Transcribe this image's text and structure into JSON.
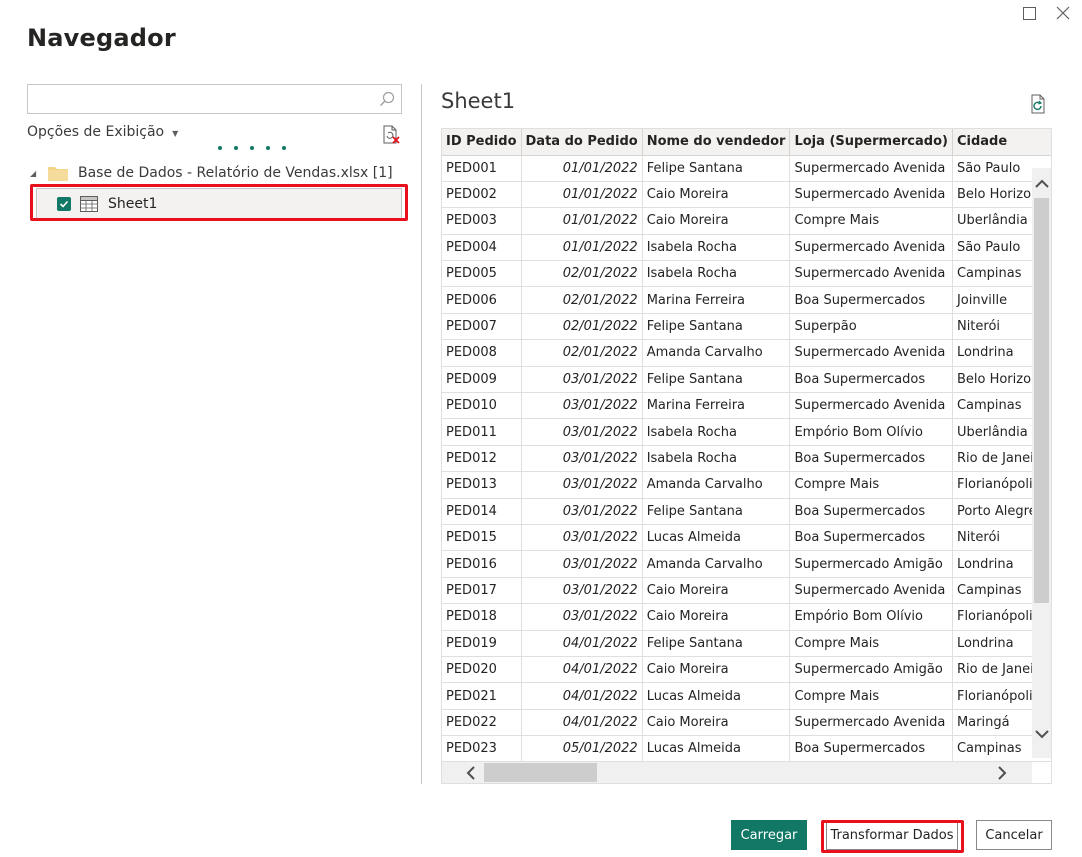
{
  "window": {
    "maximize_icon": "maximize-icon",
    "close_icon": "close-icon"
  },
  "title": "Navegador",
  "search": {
    "value": "",
    "placeholder": "",
    "icon": "search-icon"
  },
  "view_options": {
    "label": "Opções de Exibição",
    "icon": "chevron-down-icon"
  },
  "tree": {
    "root_label": "Base de Dados - Relatório de Vendas.xlsx [1]",
    "item_label": "Sheet1",
    "item_checked": true
  },
  "preview": {
    "title": "Sheet1",
    "columns": [
      "ID Pedido",
      "Data do Pedido",
      "Nome do vendedor",
      "Loja (Supermercado)",
      "Cidade"
    ],
    "rows": [
      [
        "PED001",
        "01/01/2022",
        "Felipe Santana",
        "Supermercado Avenida",
        "São Paulo"
      ],
      [
        "PED002",
        "01/01/2022",
        "Caio Moreira",
        "Supermercado Avenida",
        "Belo Horizonte"
      ],
      [
        "PED003",
        "01/01/2022",
        "Caio Moreira",
        "Compre Mais",
        "Uberlândia"
      ],
      [
        "PED004",
        "01/01/2022",
        "Isabela Rocha",
        "Supermercado Avenida",
        "São Paulo"
      ],
      [
        "PED005",
        "02/01/2022",
        "Isabela Rocha",
        "Supermercado Avenida",
        "Campinas"
      ],
      [
        "PED006",
        "02/01/2022",
        "Marina Ferreira",
        "Boa Supermercados",
        "Joinville"
      ],
      [
        "PED007",
        "02/01/2022",
        "Felipe Santana",
        "Superpão",
        "Niterói"
      ],
      [
        "PED008",
        "02/01/2022",
        "Amanda Carvalho",
        "Supermercado Avenida",
        "Londrina"
      ],
      [
        "PED009",
        "03/01/2022",
        "Felipe Santana",
        "Boa Supermercados",
        "Belo Horizonte"
      ],
      [
        "PED010",
        "03/01/2022",
        "Marina Ferreira",
        "Supermercado Avenida",
        "Campinas"
      ],
      [
        "PED011",
        "03/01/2022",
        "Isabela Rocha",
        "Empório Bom Olívio",
        "Uberlândia"
      ],
      [
        "PED012",
        "03/01/2022",
        "Isabela Rocha",
        "Boa Supermercados",
        "Rio de Janeiro"
      ],
      [
        "PED013",
        "03/01/2022",
        "Amanda Carvalho",
        "Compre Mais",
        "Florianópolis"
      ],
      [
        "PED014",
        "03/01/2022",
        "Felipe Santana",
        "Boa Supermercados",
        "Porto Alegre"
      ],
      [
        "PED015",
        "03/01/2022",
        "Lucas Almeida",
        "Boa Supermercados",
        "Niterói"
      ],
      [
        "PED016",
        "03/01/2022",
        "Amanda Carvalho",
        "Supermercado Amigão",
        "Londrina"
      ],
      [
        "PED017",
        "03/01/2022",
        "Caio Moreira",
        "Supermercado Avenida",
        "Campinas"
      ],
      [
        "PED018",
        "03/01/2022",
        "Caio Moreira",
        "Empório Bom Olívio",
        "Florianópolis"
      ],
      [
        "PED019",
        "04/01/2022",
        "Felipe Santana",
        "Compre Mais",
        "Londrina"
      ],
      [
        "PED020",
        "04/01/2022",
        "Caio Moreira",
        "Supermercado Amigão",
        "Rio de Janeiro"
      ],
      [
        "PED021",
        "04/01/2022",
        "Lucas Almeida",
        "Compre Mais",
        "Florianópolis"
      ],
      [
        "PED022",
        "04/01/2022",
        "Caio Moreira",
        "Supermercado Avenida",
        "Maringá"
      ],
      [
        "PED023",
        "05/01/2022",
        "Lucas Almeida",
        "Boa Supermercados",
        "Campinas"
      ]
    ]
  },
  "buttons": {
    "load": "Carregar",
    "transform": "Transformar Dados",
    "cancel": "Cancelar"
  },
  "colors": {
    "accent": "#117865",
    "highlight": "#e8101d"
  }
}
